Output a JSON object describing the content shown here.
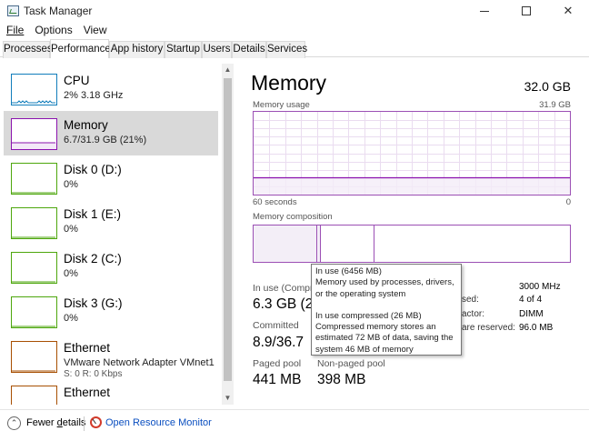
{
  "window": {
    "title": "Task Manager",
    "controls": {
      "minimize": "minimize",
      "maximize": "maximize",
      "close": "✕"
    }
  },
  "menu": [
    "File",
    "Options",
    "View"
  ],
  "tabs": [
    "Processes",
    "Performance",
    "App history",
    "Startup",
    "Users",
    "Details",
    "Services"
  ],
  "active_tab": "Performance",
  "resources": [
    {
      "name": "CPU",
      "sub": "2% 3.18 GHz",
      "color": "#117dbb",
      "selected": false
    },
    {
      "name": "Memory",
      "sub": "6.7/31.9 GB (21%)",
      "color": "#8b12ae",
      "selected": true
    },
    {
      "name": "Disk 0 (D:)",
      "sub": "0%",
      "color": "#4da60c",
      "selected": false
    },
    {
      "name": "Disk 1 (E:)",
      "sub": "0%",
      "color": "#4da60c",
      "selected": false
    },
    {
      "name": "Disk 2 (C:)",
      "sub": "0%",
      "color": "#4da60c",
      "selected": false
    },
    {
      "name": "Disk 3 (G:)",
      "sub": "0%",
      "color": "#4da60c",
      "selected": false
    },
    {
      "name": "Ethernet",
      "sub": "VMware Network Adapter VMnet1",
      "sub2": "S: 0 R: 0 Kbps",
      "color": "#a74f01",
      "selected": false
    },
    {
      "name": "Ethernet",
      "sub": "",
      "color": "#a74f01",
      "selected": false
    }
  ],
  "memory": {
    "title": "Memory",
    "total": "32.0 GB",
    "usage_label": "Memory usage",
    "usage_max": "31.9 GB",
    "usage_fraction": 0.21,
    "time_label": "60 seconds",
    "time_zero": "0",
    "composition_label": "Memory composition",
    "stats": {
      "in_use_label": "In use (Compre",
      "in_use_value": "6.3 GB (2",
      "committed_label": "Committed",
      "committed_value": "8.9/36.7",
      "paged_label": "Paged pool",
      "paged_value": "441 MB",
      "nonpaged_label": "Non-paged pool",
      "nonpaged_value": "398 MB"
    },
    "details": [
      {
        "label": "",
        "value": "3000 MHz"
      },
      {
        "label": "sed:",
        "value": "4 of 4"
      },
      {
        "label": "actor:",
        "value": "DIMM"
      },
      {
        "label": "are reserved:",
        "value": "96.0 MB"
      }
    ]
  },
  "tooltip": {
    "title1": "In use (6456 MB)",
    "body1": "Memory used by processes, drivers, or the operating system",
    "title2": "In use compressed (26 MB)",
    "body2": "Compressed memory stores an estimated 72 MB of data, saving the system 46 MB of memory"
  },
  "footer": {
    "fewer_prefix": "Fewer ",
    "fewer_underlined": "d",
    "fewer_suffix": "etails",
    "resource_monitor": "Open Resource Monitor"
  }
}
